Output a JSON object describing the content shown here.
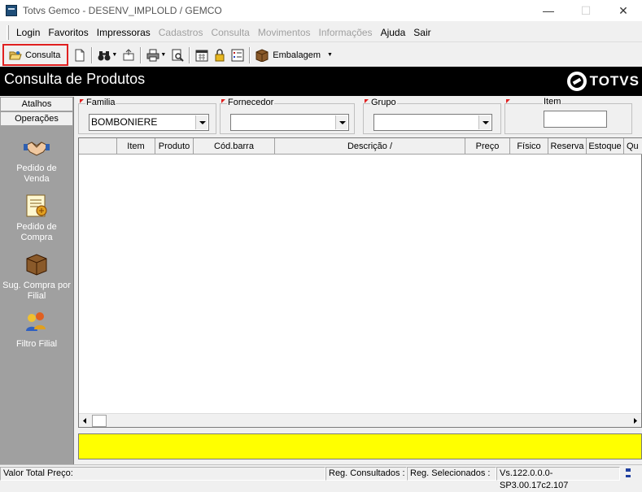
{
  "window": {
    "title": "Totvs Gemco - DESENV_IMPLOLD / GEMCO",
    "minimize": "—",
    "maximize": "☐",
    "close": "✕"
  },
  "menu": [
    {
      "label": "Login",
      "enabled": true
    },
    {
      "label": "Favoritos",
      "enabled": true
    },
    {
      "label": "Impressoras",
      "enabled": true
    },
    {
      "label": "Cadastros",
      "enabled": false
    },
    {
      "label": "Consulta",
      "enabled": false
    },
    {
      "label": "Movimentos",
      "enabled": false
    },
    {
      "label": "Informações",
      "enabled": false
    },
    {
      "label": "Ajuda",
      "enabled": true
    },
    {
      "label": "Sair",
      "enabled": true
    }
  ],
  "toolbar": {
    "consulta_label": "Consulta",
    "embalagem_label": "Embalagem"
  },
  "header": {
    "title": "Consulta de Produtos",
    "logo_text": "TOTVS"
  },
  "sidebar": {
    "tab_atalhos": "Atalhos",
    "tab_operacoes": "Operações",
    "items": [
      {
        "label": "Pedido de Venda",
        "icon": "handshake-icon"
      },
      {
        "label": "Pedido de Compra",
        "icon": "purchase-order-icon"
      },
      {
        "label": "Sug. Compra por Filial",
        "icon": "box-icon"
      },
      {
        "label": "Filtro Filial",
        "icon": "filter-people-icon"
      }
    ]
  },
  "filters": {
    "familia_label": "Familia",
    "familia_value": "BOMBONIERE",
    "fornecedor_label": "Fornecedor",
    "fornecedor_value": "",
    "grupo_label": "Grupo",
    "grupo_value": "",
    "item_label": "Item",
    "item_value": ""
  },
  "grid": {
    "columns": [
      "",
      "Item",
      "Produto",
      "Cód.barra",
      "Descrição  /",
      "Preço",
      "Físico",
      "Reserva",
      "Estoque",
      "Qu"
    ]
  },
  "status": {
    "valor_total": "Valor Total Preço:",
    "reg_consultados": "Reg. Consultados :",
    "reg_selecionados": "Reg. Selecionados :",
    "version": "Vs.122.0.0.0-SP3.00.17c2.107"
  },
  "colors": {
    "header_bg": "#000000",
    "sidebar_bg": "#a0a0a0",
    "highlight_box": "#e02020",
    "message_bar": "#ffff00"
  }
}
